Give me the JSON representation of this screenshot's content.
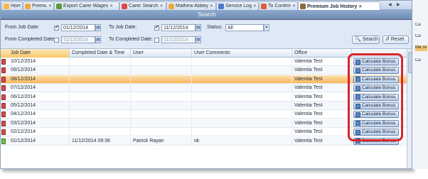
{
  "tabs": [
    {
      "label": "Home",
      "icon": "home-icon",
      "closable": false
    },
    {
      "label": "Premium",
      "icon": "folder-icon",
      "closable": true
    },
    {
      "label": "Export Carer Wages",
      "icon": "export-icon",
      "closable": true
    },
    {
      "label": "Carer Search",
      "icon": "search-icon",
      "closable": true
    },
    {
      "label": "Mathew Abbey",
      "icon": "person-icon",
      "closable": true
    },
    {
      "label": "Service Log",
      "icon": "document-icon",
      "closable": true
    },
    {
      "label": "To Confirm",
      "icon": "confirm-icon",
      "closable": true
    },
    {
      "label": "Premium Job History",
      "icon": "history-icon",
      "closable": true,
      "active": true
    }
  ],
  "search_panel": {
    "title": "Search",
    "from_job_date_label": "From Job Date:",
    "from_job_date_value": "01/12/2014",
    "to_job_date_label": "To Job Date:",
    "to_job_date_value": "11/12/2014",
    "status_label": "Status:",
    "status_value": "All",
    "from_completed_date_label": "From Completed Date:",
    "from_completed_date_value": "11/12/2014",
    "to_completed_date_label": "To Completed Date:",
    "to_completed_date_value": "11/12/2014",
    "search_button": "Search",
    "reset_button": "Reset"
  },
  "grid": {
    "columns": [
      "Job Date",
      "Completed Date & Time",
      "User",
      "User Comments",
      "Office"
    ],
    "action_label": "Calculate Bonus",
    "rows": [
      {
        "job_date": "10/12/2014",
        "completed": "",
        "user": "",
        "comments": "",
        "office": "Valentia Test",
        "status": "red"
      },
      {
        "job_date": "09/12/2014",
        "completed": "",
        "user": "",
        "comments": "",
        "office": "Valentia Test",
        "status": "red"
      },
      {
        "job_date": "08/12/2014",
        "completed": "",
        "user": "",
        "comments": "",
        "office": "Valentia Test",
        "status": "red",
        "selected": true
      },
      {
        "job_date": "07/12/2014",
        "completed": "",
        "user": "",
        "comments": "",
        "office": "Valentia Test",
        "status": "red"
      },
      {
        "job_date": "06/12/2014",
        "completed": "",
        "user": "",
        "comments": "",
        "office": "Valentia Test",
        "status": "red"
      },
      {
        "job_date": "05/12/2014",
        "completed": "",
        "user": "",
        "comments": "",
        "office": "Valentia Test",
        "status": "red"
      },
      {
        "job_date": "04/12/2014",
        "completed": "",
        "user": "",
        "comments": "",
        "office": "Valentia Test",
        "status": "red"
      },
      {
        "job_date": "03/12/2014",
        "completed": "",
        "user": "",
        "comments": "",
        "office": "Valentia Test",
        "status": "red"
      },
      {
        "job_date": "02/12/2014",
        "completed": "",
        "user": "",
        "comments": "",
        "office": "Valentia Test",
        "status": "red"
      },
      {
        "job_date": "01/12/2014",
        "completed": "11/12/2014 09:36",
        "user": "Patrick Rayan",
        "comments": "ok",
        "office": "Valentia Test",
        "status": "green"
      }
    ]
  },
  "right_strip": [
    "Ca",
    "Ca",
    "Ma Te",
    "Ca"
  ],
  "colors": {
    "highlight": "#d8272a",
    "selected_row": "#f8b75b",
    "header_bar": "#6d8cb6",
    "status_red": "#d84a4a",
    "status_green": "#6cc24a"
  }
}
